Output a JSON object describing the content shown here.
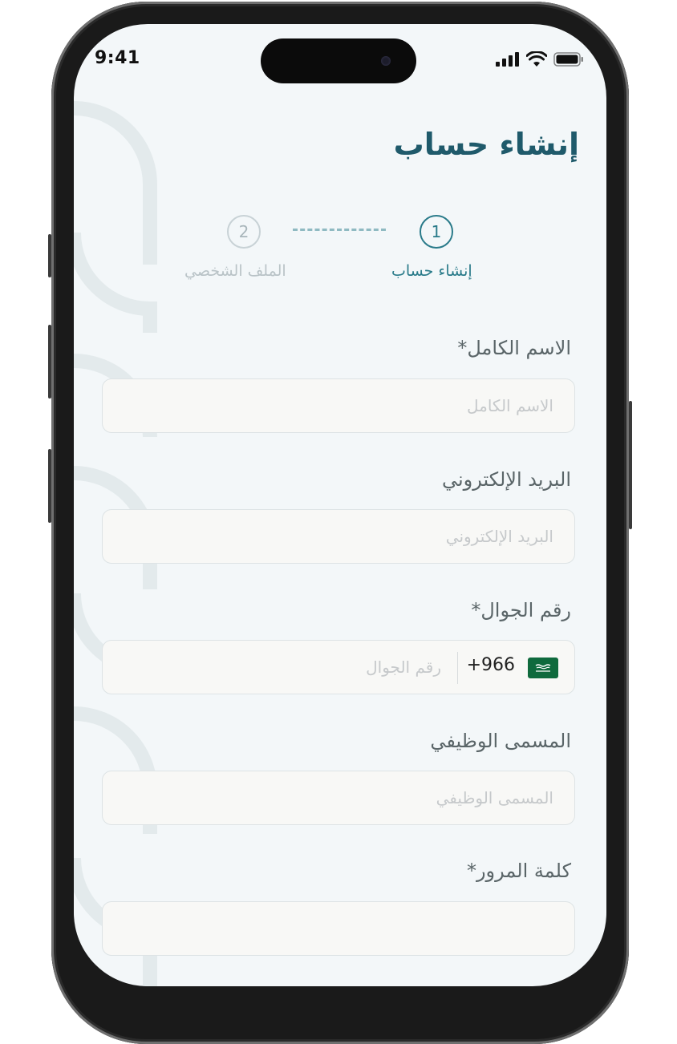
{
  "status_bar": {
    "time": "9:41",
    "icons": [
      "signal-icon",
      "wifi-icon",
      "battery-icon"
    ]
  },
  "page": {
    "title": "إنشاء حساب"
  },
  "stepper": {
    "steps": [
      {
        "number": "1",
        "label": "إنشاء حساب",
        "state": "active"
      },
      {
        "number": "2",
        "label": "الملف الشخصي",
        "state": "inactive"
      }
    ]
  },
  "form": {
    "full_name": {
      "label": "الاسم الكامل*",
      "placeholder": "الاسم الكامل",
      "value": ""
    },
    "email": {
      "label": "البريد الإلكتروني",
      "placeholder": "البريد الإلكتروني",
      "value": ""
    },
    "mobile": {
      "label": "رقم الجوال*",
      "placeholder": "رقم الجوال",
      "country_code": "+966",
      "flag": "saudi-flag-icon",
      "value": ""
    },
    "job_title": {
      "label": "المسمى الوظيفي",
      "placeholder": "المسمى الوظيفي",
      "value": ""
    },
    "password": {
      "label": "كلمة المرور*",
      "placeholder": "",
      "value": ""
    }
  },
  "colors": {
    "primary": "#1f5a6b",
    "accent": "#2a7b8a",
    "background": "#f3f7f9",
    "field_bg": "#f8f8f6",
    "flag_green": "#0f6a3d"
  }
}
